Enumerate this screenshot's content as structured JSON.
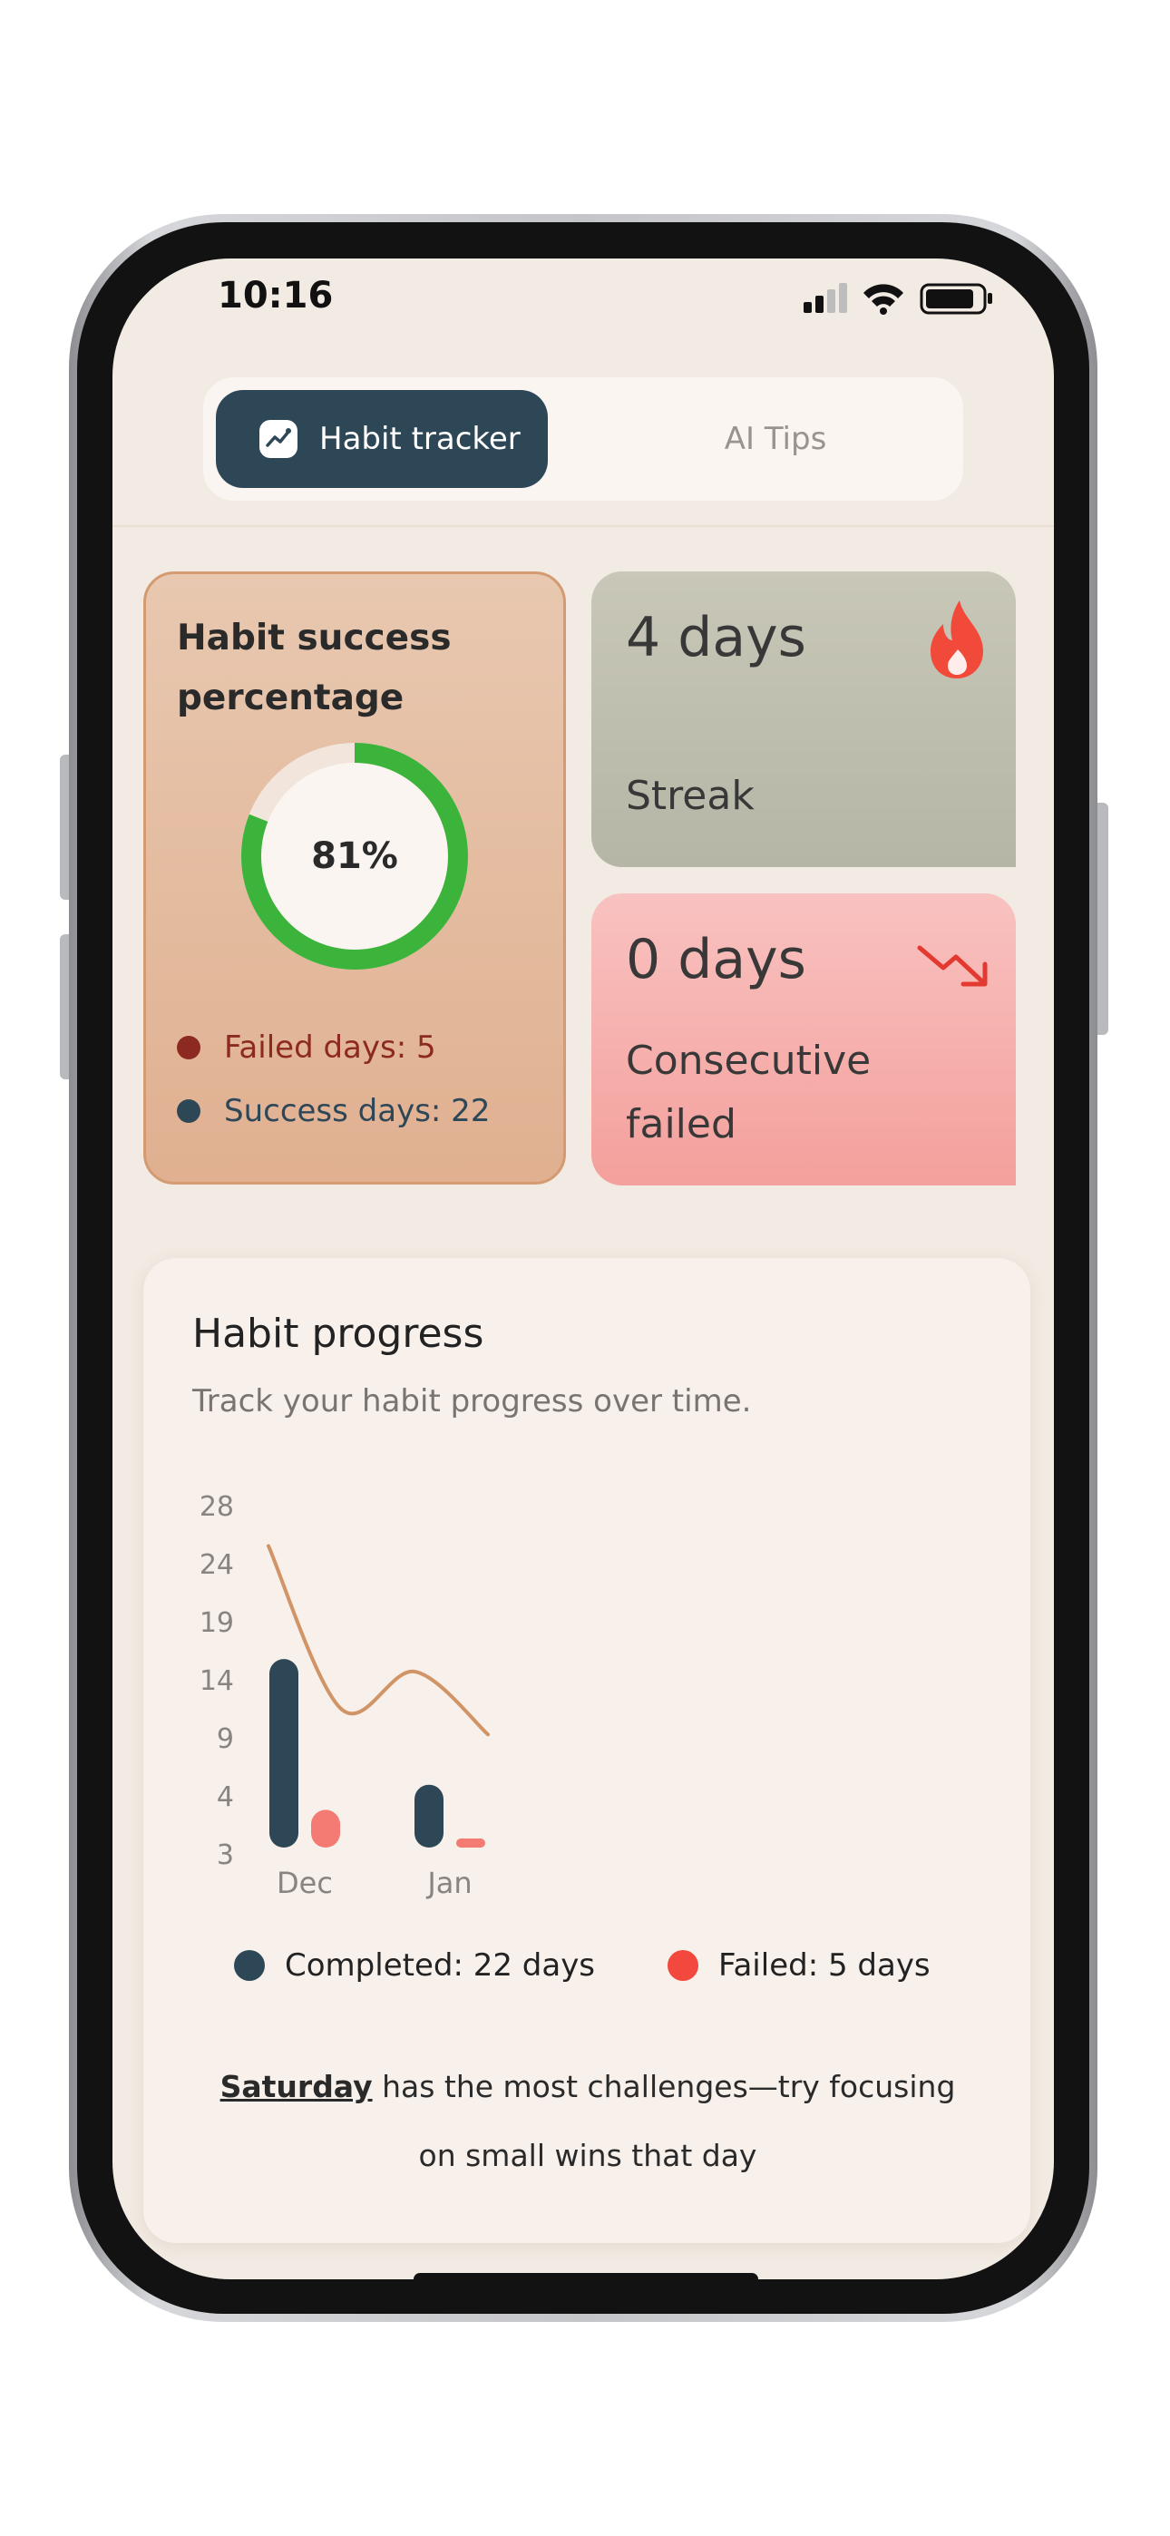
{
  "status_bar": {
    "time": "10:16"
  },
  "tabs": [
    {
      "label": "Habit tracker",
      "active": true,
      "icon": "trend-chart-icon"
    },
    {
      "label": "AI Tips",
      "active": false
    }
  ],
  "success_card": {
    "title": "Habit success percentage",
    "percent_label": "81%",
    "percent_value": 81,
    "legend": [
      {
        "label": "Failed days: 5",
        "color": "#8c2a22"
      },
      {
        "label": "Success days: 22",
        "color": "#2e4757"
      }
    ]
  },
  "streak_card": {
    "value": "4 days",
    "label": "Streak",
    "icon": "flame-icon"
  },
  "failed_card": {
    "value": "0 days",
    "label": "Consecutive failed",
    "icon": "trending-down-icon"
  },
  "progress_card": {
    "title": "Habit progress",
    "subtitle": "Track your habit progress over time.",
    "legend": [
      {
        "label": "Completed: 22 days",
        "color": "#2e4757"
      },
      {
        "label": "Failed: 5 days",
        "color": "#f2483d"
      }
    ],
    "insight_day": "Saturday",
    "insight_text": " has the most challenges—try focusing on small wins that day"
  },
  "chart_data": {
    "type": "bar",
    "categories": [
      "Dec",
      "Jan"
    ],
    "y_ticks": [
      "28",
      "24",
      "19",
      "14",
      "9",
      "4",
      "3"
    ],
    "series": [
      {
        "name": "Completed",
        "values": [
          15,
          5
        ],
        "color": "#2e4757"
      },
      {
        "name": "Failed",
        "values": [
          3,
          0.5
        ],
        "color": "#f47a74"
      }
    ],
    "trend_line": {
      "values": [
        24,
        11,
        14,
        9
      ],
      "color": "#d19466"
    },
    "ylim": [
      0,
      28
    ]
  },
  "colors": {
    "accent": "#2e4757",
    "background": "#f2ebe3",
    "donut_progress": "#3cb43c",
    "streak_card": "#c3c2b2",
    "failed_card": "#f6acaa",
    "flame": "#f24a3a"
  }
}
